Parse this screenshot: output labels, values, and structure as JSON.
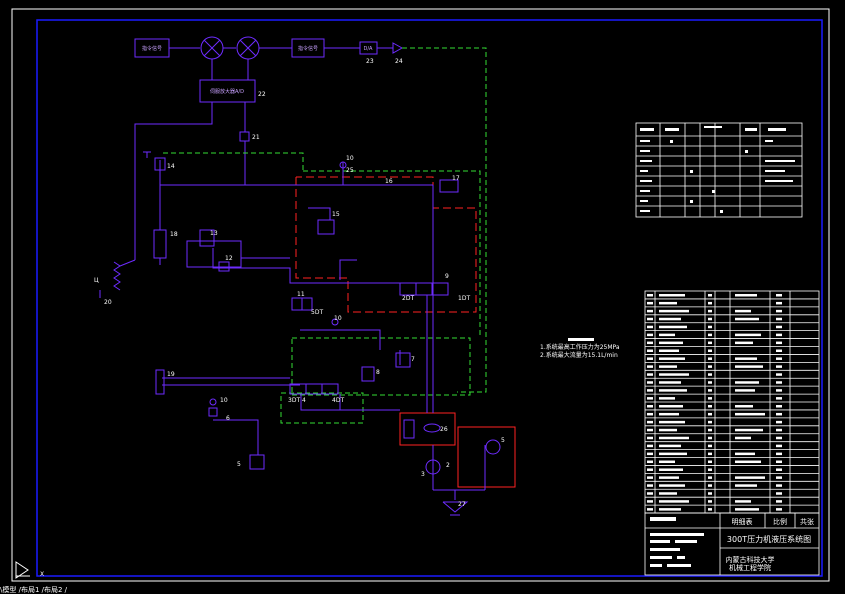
{
  "drawing": {
    "block_cmd_left": "指令信号",
    "block_cmd_right": "指令信号",
    "block_amp": "D/A",
    "block_controller": "伺服放大器A/D",
    "labels": {
      "n1": "1",
      "n2": "2",
      "n3": "3",
      "n4": "4",
      "n5": "5",
      "n6": "6",
      "n7": "7",
      "n8": "8",
      "n9": "9",
      "n10a": "10",
      "n10b": "10",
      "n10c": "10",
      "n11": "11",
      "n12": "12",
      "n13": "13",
      "n14": "14",
      "n15": "15",
      "n16": "16",
      "n17": "17",
      "n18": "18",
      "n19": "19",
      "n20": "20",
      "n21": "21",
      "n22": "22",
      "n23": "23",
      "n24": "24",
      "n25": "25",
      "n26": "26",
      "n27": "27",
      "sol_1dt": "1DT",
      "sol_2dt": "2DT",
      "sol_3dt": "3DT",
      "sol_4dt": "4DT",
      "sol_5dt": "5DT"
    },
    "notes": {
      "line1": "1.系统最高工作压力为25MPa",
      "line2": "2.系统最大流量为15.1L/min"
    }
  },
  "title_block": {
    "header_detail": "明细表",
    "header_scale": "比例",
    "header_sheet": "共张",
    "drawing_title": "300T压力机液压系统图",
    "school": "内蒙古科技大学",
    "department": "机械工程学院"
  },
  "status_bar": {
    "text": "\\模型 /布局1 /布局2 /"
  },
  "colors": {
    "pipe": "#6e2cff",
    "pilot": "#33dd33",
    "boundary": "#ff2222",
    "border": "#1a1aff"
  }
}
